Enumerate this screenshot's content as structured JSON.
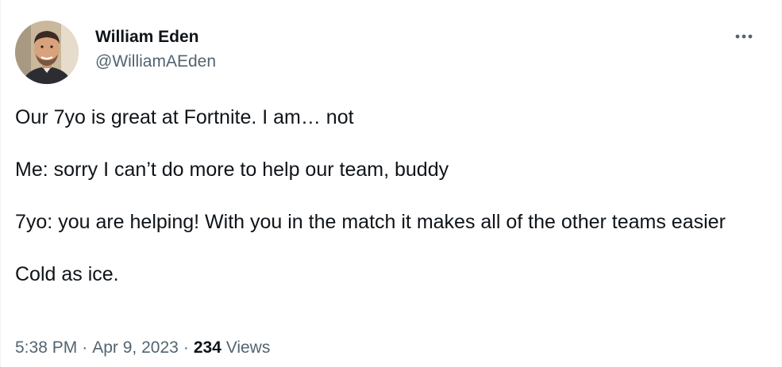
{
  "tweet": {
    "author": {
      "display_name": "William Eden",
      "handle": "@WilliamAEden"
    },
    "more_icon": "more-horizontal-icon",
    "paragraphs": [
      "Our 7yo is great at Fortnite. I am… not",
      "Me: sorry I can’t do more to help our team, buddy",
      "7yo: you are helping! With you in the match it makes all of the other teams easier",
      "Cold as ice."
    ],
    "time": "5:38 PM",
    "separator": "·",
    "date": "Apr 9, 2023",
    "views_count": "234",
    "views_label": "Views"
  },
  "colors": {
    "text": "#0f1419",
    "secondary": "#536471",
    "border": "#eff3f4"
  }
}
